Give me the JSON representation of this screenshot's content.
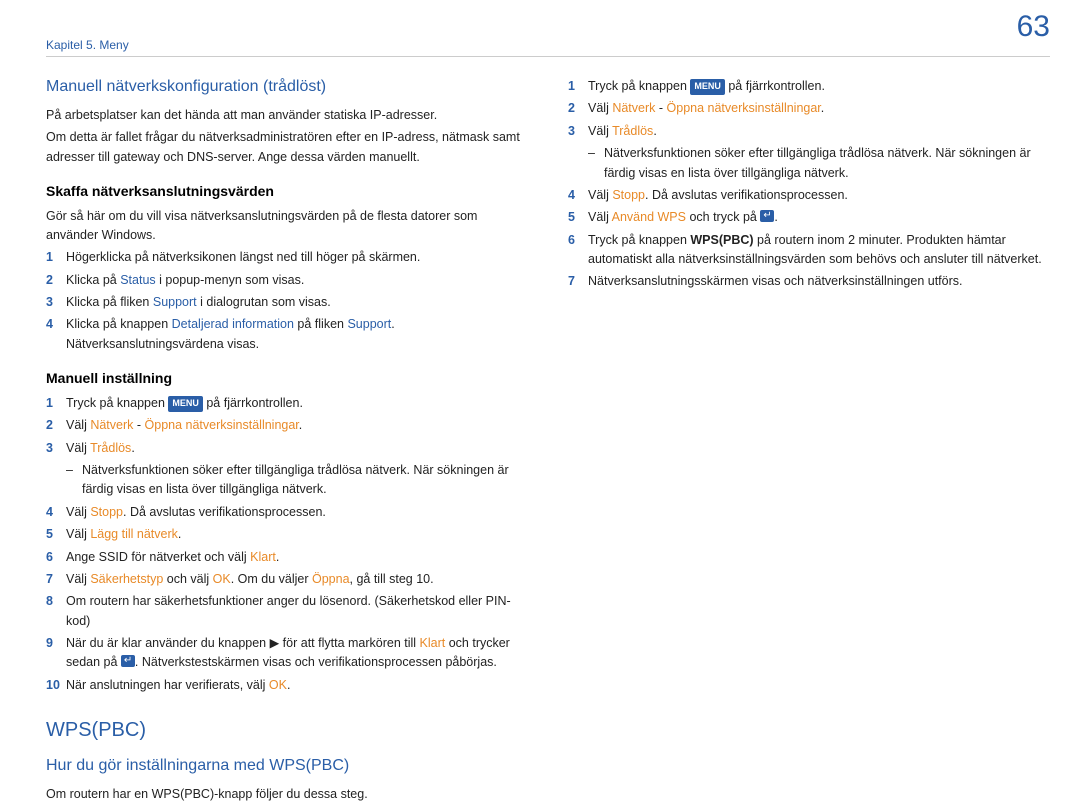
{
  "header": {
    "chapter": "Kapitel 5. Meny",
    "page": "63"
  },
  "left": {
    "h1": "Manuell nätverkskonfiguration (trådlöst)",
    "p1": "På arbetsplatser kan det hända att man använder statiska IP-adresser.",
    "p2": "Om detta är fallet frågar du nätverksadministratören efter en IP-adress, nätmask samt adresser till gateway och DNS-server. Ange dessa värden manuellt.",
    "h2": "Skaffa nätverksanslutningsvärden",
    "p3": "Gör så här om du vill visa nätverksanslutningsvärden på de flesta datorer som använder Windows.",
    "sk_list": {
      "n1": "1",
      "t1": "Högerklicka på nätverksikonen längst ned till höger på skärmen.",
      "n2": "2",
      "t2a": "Klicka på ",
      "t2b": "Status",
      "t2c": " i popup-menyn som visas.",
      "n3": "3",
      "t3a": "Klicka på fliken ",
      "t3b": "Support",
      "t3c": " i dialogrutan som visas.",
      "n4": "4",
      "t4a": "Klicka på knappen ",
      "t4b": "Detaljerad information",
      "t4c": " på fliken ",
      "t4d": "Support",
      "t4e": ". Nätverksanslutningsvärdena visas."
    },
    "h3": "Manuell inställning",
    "mi_list": {
      "n1": "1",
      "t1a": "Tryck på knappen ",
      "menu": "MENU",
      "t1b": " på fjärrkontrollen.",
      "n2": "2",
      "t2a": "Välj ",
      "t2b": "Nätverk",
      "t2c": " - ",
      "t2d": "Öppna nätverksinställningar",
      "t2e": ".",
      "n3": "3",
      "t3a": "Välj ",
      "t3b": "Trådlös",
      "t3c": ".",
      "dash": "‒",
      "t3sub": "Nätverksfunktionen söker efter tillgängliga trådlösa nätverk. När sökningen är färdig visas en lista över tillgängliga nätverk.",
      "n4": "4",
      "t4a": "Välj ",
      "t4b": "Stopp",
      "t4c": ". Då avslutas verifikationsprocessen.",
      "n5": "5",
      "t5a": "Välj ",
      "t5b": "Lägg till nätverk",
      "t5c": ".",
      "n6": "6",
      "t6a": "Ange SSID för nätverket och välj ",
      "t6b": "Klart",
      "t6c": ".",
      "n7": "7",
      "t7a": "Välj ",
      "t7b": "Säkerhetstyp",
      "t7c": " och välj ",
      "t7d": "OK",
      "t7e": ". Om du väljer ",
      "t7f": "Öppna",
      "t7g": ", gå till steg 10.",
      "n8": "8",
      "t8": "Om routern har säkerhetsfunktioner anger du lösenord. (Säkerhetskod eller PIN-kod)",
      "n9": "9",
      "t9a": "När du är klar använder du knappen ▶ för att flytta markören till ",
      "t9b": "Klart",
      "t9c": " och trycker sedan på ",
      "t9d": ". Nätverkstestskärmen visas och verifikationsprocessen påbörjas.",
      "n10": "10",
      "t10a": "När anslutningen har verifierats, välj ",
      "t10b": "OK",
      "t10c": "."
    },
    "h4": "WPS(PBC)",
    "h5": "Hur du gör inställningarna med WPS(PBC)",
    "p4": "Om routern har en WPS(PBC)-knapp följer du dessa steg."
  },
  "right": {
    "list": {
      "n1": "1",
      "t1a": "Tryck på knappen ",
      "menu": "MENU",
      "t1b": " på fjärrkontrollen.",
      "n2": "2",
      "t2a": "Välj ",
      "t2b": "Nätverk",
      "t2c": " - ",
      "t2d": "Öppna nätverksinställningar",
      "t2e": ".",
      "n3": "3",
      "t3a": "Välj ",
      "t3b": "Trådlös",
      "t3c": ".",
      "dash": "‒",
      "t3sub": "Nätverksfunktionen söker efter tillgängliga trådlösa nätverk. När sökningen är färdig visas en lista över tillgängliga nätverk.",
      "n4": "4",
      "t4a": "Välj ",
      "t4b": "Stopp",
      "t4c": ". Då avslutas verifikationsprocessen.",
      "n5": "5",
      "t5a": "Välj ",
      "t5b": "Använd WPS",
      "t5c": " och tryck på ",
      "t5d": ".",
      "n6": "6",
      "t6a": "Tryck på knappen ",
      "t6b": "WPS(PBC)",
      "t6c": " på routern inom 2 minuter. Produkten hämtar automatiskt alla nätverksinställningsvärden som behövs och ansluter till nätverket.",
      "n7": "7",
      "t7": "Nätverksanslutningsskärmen visas och nätverksinställningen utförs."
    }
  }
}
